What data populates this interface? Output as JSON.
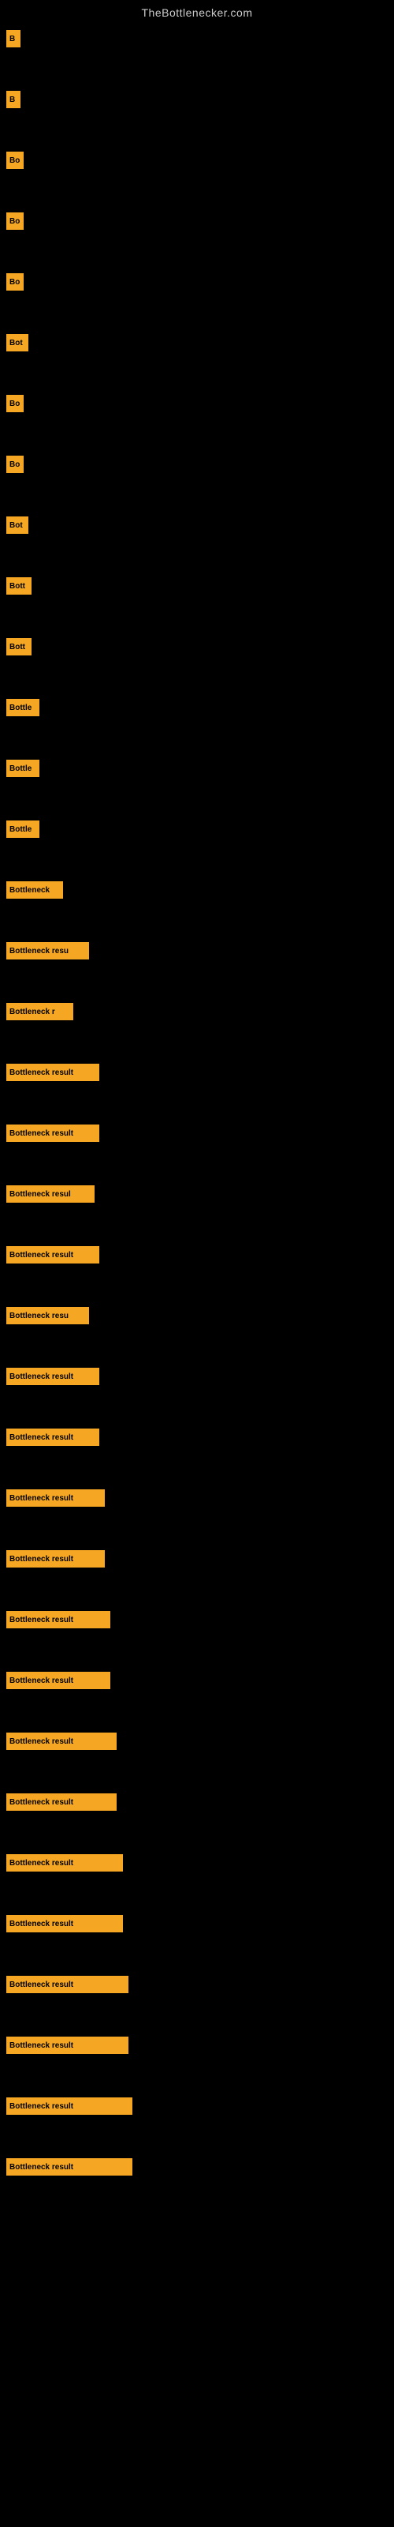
{
  "site_title": "TheBottlenecker.com",
  "bars": [
    {
      "id": 1,
      "label": "B",
      "width": 18
    },
    {
      "id": 2,
      "label": "B",
      "width": 18
    },
    {
      "id": 3,
      "label": "Bo",
      "width": 22
    },
    {
      "id": 4,
      "label": "Bo",
      "width": 22
    },
    {
      "id": 5,
      "label": "Bo",
      "width": 22
    },
    {
      "id": 6,
      "label": "Bot",
      "width": 28
    },
    {
      "id": 7,
      "label": "Bo",
      "width": 22
    },
    {
      "id": 8,
      "label": "Bo",
      "width": 22
    },
    {
      "id": 9,
      "label": "Bot",
      "width": 28
    },
    {
      "id": 10,
      "label": "Bott",
      "width": 32
    },
    {
      "id": 11,
      "label": "Bott",
      "width": 32
    },
    {
      "id": 12,
      "label": "Bottle",
      "width": 42
    },
    {
      "id": 13,
      "label": "Bottle",
      "width": 42
    },
    {
      "id": 14,
      "label": "Bottle",
      "width": 42
    },
    {
      "id": 15,
      "label": "Bottleneck",
      "width": 72
    },
    {
      "id": 16,
      "label": "Bottleneck resu",
      "width": 105
    },
    {
      "id": 17,
      "label": "Bottleneck r",
      "width": 85
    },
    {
      "id": 18,
      "label": "Bottleneck result",
      "width": 118
    },
    {
      "id": 19,
      "label": "Bottleneck result",
      "width": 118
    },
    {
      "id": 20,
      "label": "Bottleneck resul",
      "width": 112
    },
    {
      "id": 21,
      "label": "Bottleneck result",
      "width": 118
    },
    {
      "id": 22,
      "label": "Bottleneck resu",
      "width": 105
    },
    {
      "id": 23,
      "label": "Bottleneck result",
      "width": 118
    },
    {
      "id": 24,
      "label": "Bottleneck result",
      "width": 118
    },
    {
      "id": 25,
      "label": "Bottleneck result",
      "width": 125
    },
    {
      "id": 26,
      "label": "Bottleneck result",
      "width": 125
    },
    {
      "id": 27,
      "label": "Bottleneck result",
      "width": 132
    },
    {
      "id": 28,
      "label": "Bottleneck result",
      "width": 132
    },
    {
      "id": 29,
      "label": "Bottleneck result",
      "width": 140
    },
    {
      "id": 30,
      "label": "Bottleneck result",
      "width": 140
    },
    {
      "id": 31,
      "label": "Bottleneck result",
      "width": 148
    },
    {
      "id": 32,
      "label": "Bottleneck result",
      "width": 148
    },
    {
      "id": 33,
      "label": "Bottleneck result",
      "width": 155
    },
    {
      "id": 34,
      "label": "Bottleneck result",
      "width": 155
    },
    {
      "id": 35,
      "label": "Bottleneck result",
      "width": 160
    },
    {
      "id": 36,
      "label": "Bottleneck result",
      "width": 160
    }
  ]
}
